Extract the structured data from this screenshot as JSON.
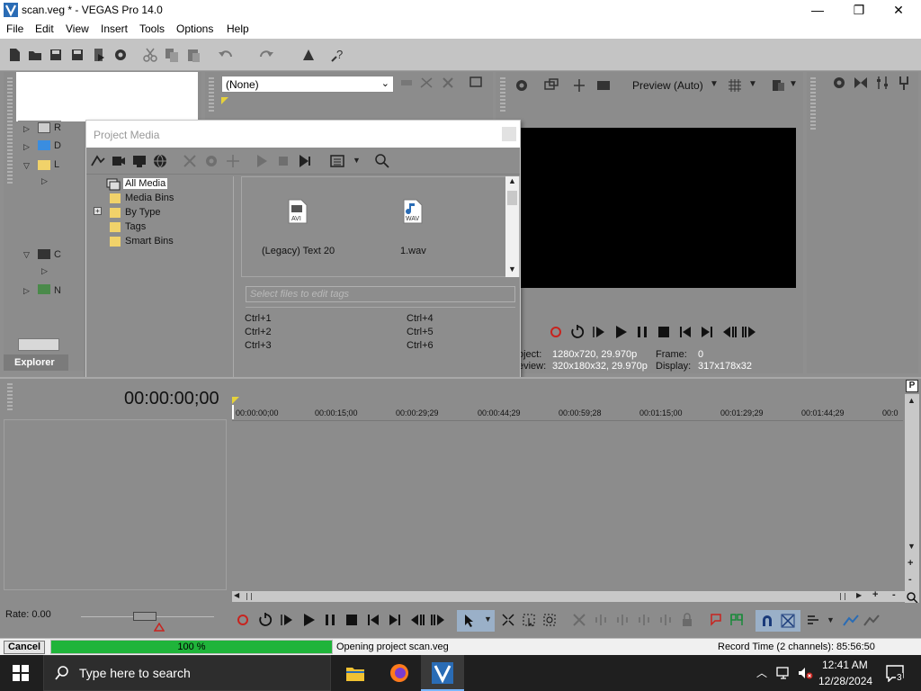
{
  "window": {
    "title": "scan.veg * - VEGAS Pro 14.0",
    "minimize": "—",
    "maximize": "❐",
    "close": "✕"
  },
  "menu": [
    "File",
    "Edit",
    "View",
    "Insert",
    "Tools",
    "Options",
    "Help"
  ],
  "trimmer": {
    "selected": "(None)"
  },
  "explorer": {
    "tab_label": "Explorer",
    "tree_letters": [
      "R",
      "D",
      "L",
      "C",
      "N"
    ]
  },
  "preview": {
    "mode": "Preview (Auto)",
    "project_label": "oject:",
    "project_value": "1280x720, 29.970p",
    "preview_label": "eview:",
    "preview_value": "320x180x32, 29.970p",
    "frame_label": "Frame:",
    "frame_value": "0",
    "display_label": "Display:",
    "display_value": "317x178x32"
  },
  "project_media": {
    "title": "Project Media",
    "tree": [
      "All Media",
      "Media Bins",
      "By Type",
      "Tags",
      "Smart Bins"
    ],
    "expand_glyph": "+",
    "files": [
      {
        "name": "(Legacy) Text 20",
        "badge": "AVI"
      },
      {
        "name": "1.wav",
        "badge": "WAV"
      }
    ],
    "tag_placeholder": "Select files to edit tags",
    "shortcuts_left": [
      "Ctrl+1",
      "Ctrl+2",
      "Ctrl+3"
    ],
    "shortcuts_right": [
      "Ctrl+4",
      "Ctrl+5",
      "Ctrl+6"
    ]
  },
  "timeline": {
    "timecode": "00:00:00;00",
    "ruler": [
      "00:00:00;00",
      "00:00:15;00",
      "00:00:29;29",
      "00:00:44;29",
      "00:00:59;28",
      "00:01:15;00",
      "00:01:29;29",
      "00:01:44;29",
      "00:0"
    ],
    "rate": "Rate: 0.00",
    "p_glyph": "P"
  },
  "status": {
    "cancel": "Cancel",
    "progress_text": "100 %",
    "progress": 1.0,
    "message": "Opening project scan.veg",
    "record_time": "Record Time (2 channels): 85:56:50"
  },
  "taskbar": {
    "search_placeholder": "Type here to search",
    "time": "12:41 AM",
    "date": "12/28/2024",
    "notification_count": "3"
  },
  "colors": {
    "progress_fill": "#1fb43a",
    "panel_bg": "#8c8c8c",
    "taskbar_bg": "#1f1f1f",
    "record_red": "#c8231e"
  }
}
